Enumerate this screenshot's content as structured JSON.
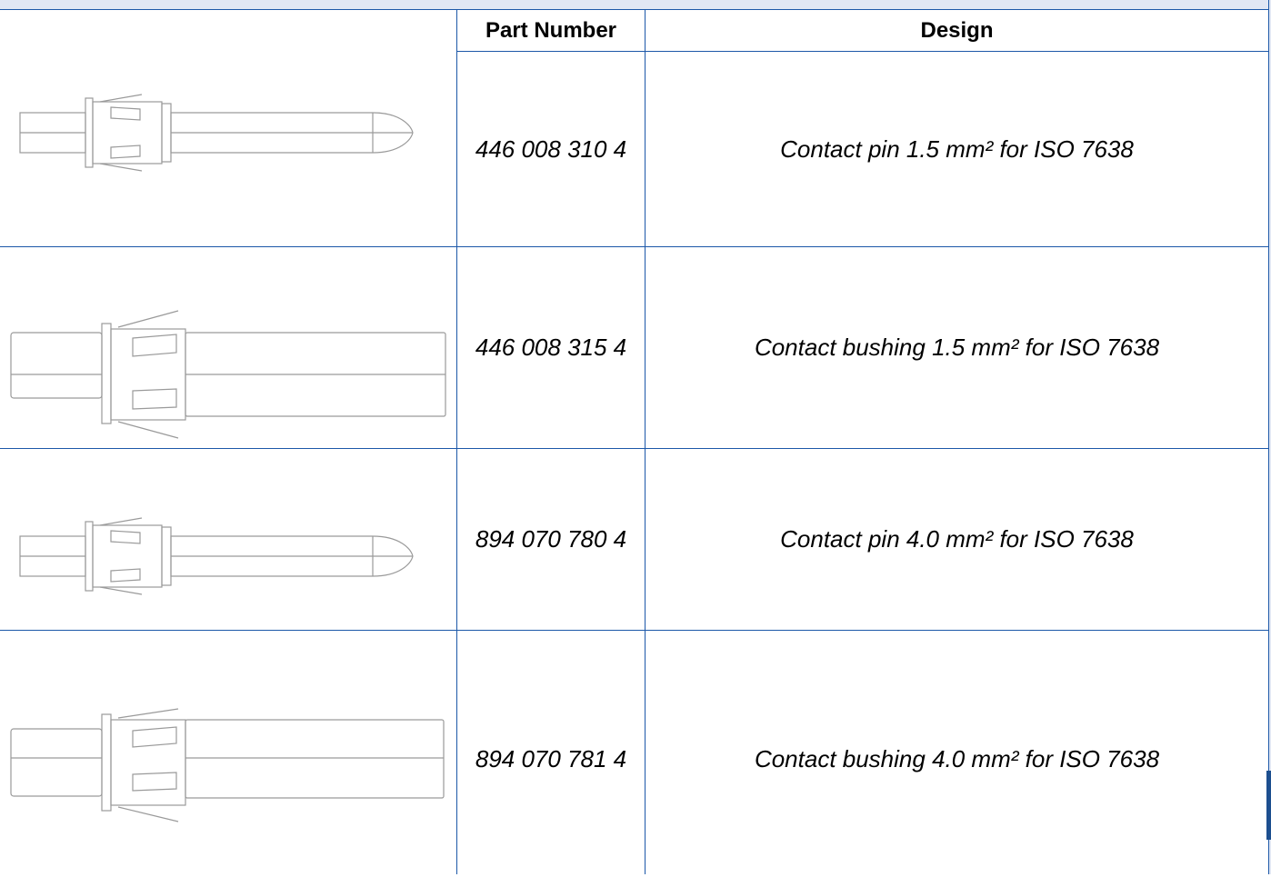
{
  "table": {
    "headers": {
      "part_number": "Part Number",
      "design": "Design"
    },
    "rows": [
      {
        "part_number": "446 008 310 4",
        "design": "Contact pin 1.5 mm² for ISO 7638",
        "image": "contact-pin-drawing"
      },
      {
        "part_number": "446 008 315 4",
        "design": "Contact bushing 1.5 mm² for ISO 7638",
        "image": "contact-bushing-drawing"
      },
      {
        "part_number": "894 070 780 4",
        "design": "Contact pin 4.0 mm² for ISO 7638",
        "image": "contact-pin-drawing"
      },
      {
        "part_number": "894 070 781 4",
        "design": "Contact bushing 4.0 mm² for ISO 7638",
        "image": "contact-bushing-drawing"
      }
    ]
  },
  "colors": {
    "grid": "#1c58a8",
    "header_band": "#e1e7f4",
    "drawing_stroke": "#9a9a9a"
  }
}
